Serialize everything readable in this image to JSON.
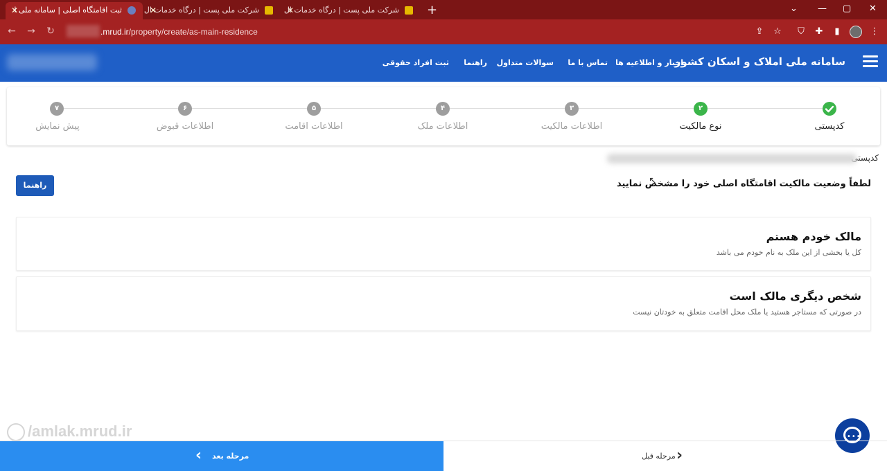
{
  "browser": {
    "tabs": [
      {
        "title": "ثبت اقامتگاه اصلی | سامانه ملی ا"
      },
      {
        "title": "شرکت ملی پست | درگاه خدمات ال"
      },
      {
        "title": "شرکت ملی پست | درگاه خدمات ال"
      }
    ],
    "url_host": ".mrud.ir",
    "url_path": "/property/create/as-main-residence"
  },
  "header": {
    "site_title": "سامانه ملی املاک و اسکان کشور",
    "nav": [
      "اخبار و اطلاعیه ها",
      "تماس با ما",
      "سوالات متداول",
      "راهنما",
      "ثبت افراد حقوقی"
    ]
  },
  "stepper": {
    "steps": [
      {
        "label": "کدپستی",
        "num": "",
        "state": "done"
      },
      {
        "label": "نوع مالکیت",
        "num": "۲",
        "state": "active"
      },
      {
        "label": "اطلاعات مالکیت",
        "num": "۳",
        "state": "pending"
      },
      {
        "label": "اطلاعات ملک",
        "num": "۴",
        "state": "pending"
      },
      {
        "label": "اطلاعات اقامت",
        "num": "۵",
        "state": "pending"
      },
      {
        "label": "اطلاعات قبوض",
        "num": "۶",
        "state": "pending"
      },
      {
        "label": "پیش نمایش",
        "num": "۷",
        "state": "pending"
      }
    ]
  },
  "main": {
    "postal_label": "کدپستی",
    "prompt": "لطفاً وضعیت مالکیت اقامتگاه اصلی خود را مشخص نمایید",
    "help_button": "راهنما",
    "options": [
      {
        "title": "مالک خودم هستم",
        "desc": "کل یا بخشی از این ملک به نام خودم می باشد"
      },
      {
        "title": "شخص دیگری مالک است",
        "desc": "در صورتی که مستاجر هستید یا ملک محل اقامت متعلق به خودتان نیست"
      }
    ]
  },
  "watermark": "/amlak.mrud.ir",
  "footer": {
    "next_label": "مرحله بعد",
    "prev_label": "مرحله قبل"
  },
  "colors": {
    "header": "#1f5fc7",
    "next": "#2a8df0",
    "step_active": "#3bb54a",
    "step_pending": "#9e9e9e"
  }
}
